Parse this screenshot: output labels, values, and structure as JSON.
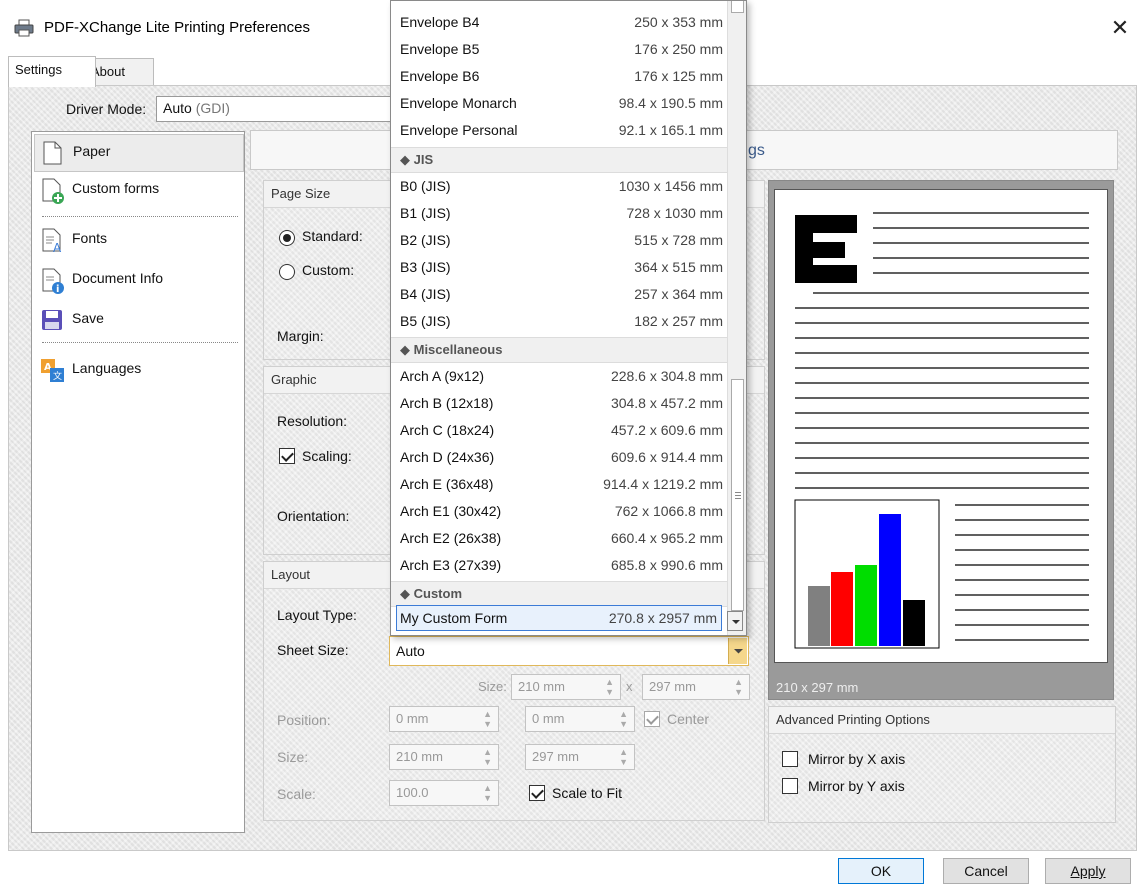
{
  "window": {
    "title": "PDF-XChange Lite Printing Preferences",
    "close_glyph": "✕",
    "tabs": [
      {
        "label": "Settings"
      },
      {
        "label": "About"
      }
    ]
  },
  "driver": {
    "label": "Driver Mode:",
    "value": "Auto",
    "value_suffix": "(GDI)"
  },
  "sidebar": {
    "items": [
      {
        "label": "Paper",
        "icon": "page-icon"
      },
      {
        "label": "Custom forms",
        "icon": "add-page-icon"
      },
      {
        "label": "Fonts",
        "icon": "font-page-icon"
      },
      {
        "label": "Document Info",
        "icon": "info-page-icon"
      },
      {
        "label": "Save",
        "icon": "floppy-disk-icon"
      },
      {
        "label": "Languages",
        "icon": "language-icon"
      }
    ]
  },
  "settings_header": {
    "partial_text": "gs"
  },
  "page_size": {
    "title": "Page Size",
    "standard_label": "Standard:",
    "custom_label": "Custom:",
    "margin_label": "Margin:"
  },
  "graphic": {
    "title": "Graphic",
    "resolution_label": "Resolution:",
    "scaling_label": "Scaling:",
    "orientation_label": "Orientation:"
  },
  "layout": {
    "title": "Layout",
    "layout_type_label": "Layout Type:",
    "sheet_size_label": "Sheet Size:",
    "sheet_size_value": "Auto",
    "size_prefix": "Size:",
    "size_w": "210 mm",
    "size_x": "x",
    "size_h": "297 mm",
    "position_label": "Position:",
    "position_x": "0 mm",
    "position_y": "0 mm",
    "center_label": "Center",
    "size_label": "Size:",
    "size2_w": "210 mm",
    "size2_h": "297 mm",
    "scale_label": "Scale:",
    "scale_value": "100.0",
    "scale_to_fit_label": "Scale to Fit"
  },
  "dropdown": {
    "group_envelope_rows": [
      {
        "name": "Envelope B4",
        "size": "250 x 353 mm"
      },
      {
        "name": "Envelope B5",
        "size": "176 x 250 mm"
      },
      {
        "name": "Envelope B6",
        "size": "176 x 125 mm"
      },
      {
        "name": "Envelope Monarch",
        "size": "98.4 x 190.5 mm"
      },
      {
        "name": "Envelope Personal",
        "size": "92.1 x 165.1 mm"
      }
    ],
    "cat_jis": "◆ JIS",
    "jis_rows": [
      {
        "name": "B0 (JIS)",
        "size": "1030 x 1456 mm"
      },
      {
        "name": "B1 (JIS)",
        "size": "728 x 1030 mm"
      },
      {
        "name": "B2 (JIS)",
        "size": "515 x 728 mm"
      },
      {
        "name": "B3 (JIS)",
        "size": "364 x 515 mm"
      },
      {
        "name": "B4 (JIS)",
        "size": "257 x 364 mm"
      },
      {
        "name": "B5 (JIS)",
        "size": "182 x 257 mm"
      }
    ],
    "cat_misc": "◆ Miscellaneous",
    "misc_rows": [
      {
        "name": "Arch A (9x12)",
        "size": "228.6 x 304.8 mm"
      },
      {
        "name": "Arch B (12x18)",
        "size": "304.8 x 457.2 mm"
      },
      {
        "name": "Arch C (18x24)",
        "size": "457.2 x 609.6 mm"
      },
      {
        "name": "Arch D (24x36)",
        "size": "609.6 x 914.4 mm"
      },
      {
        "name": "Arch E (36x48)",
        "size": "914.4 x 1219.2 mm"
      },
      {
        "name": "Arch E1 (30x42)",
        "size": "762 x 1066.8 mm"
      },
      {
        "name": "Arch E2 (26x38)",
        "size": "660.4 x 965.2 mm"
      },
      {
        "name": "Arch E3 (27x39)",
        "size": "685.8 x 990.6 mm"
      }
    ],
    "cat_custom": "◆ Custom",
    "custom_rows": [
      {
        "name": "My Custom Form",
        "size": "270.8 x 2957 mm"
      }
    ]
  },
  "preview": {
    "size_text": "210 x 297 mm",
    "bar_colors": [
      "#808080",
      "#ff0000",
      "#00dd00",
      "#0000ff",
      "#000000"
    ]
  },
  "advanced": {
    "title": "Advanced Printing Options",
    "mirror_x_label": "Mirror by X axis",
    "mirror_y_label": "Mirror by Y axis"
  },
  "buttons": {
    "ok": "OK",
    "cancel": "Cancel",
    "apply": "Apply"
  }
}
